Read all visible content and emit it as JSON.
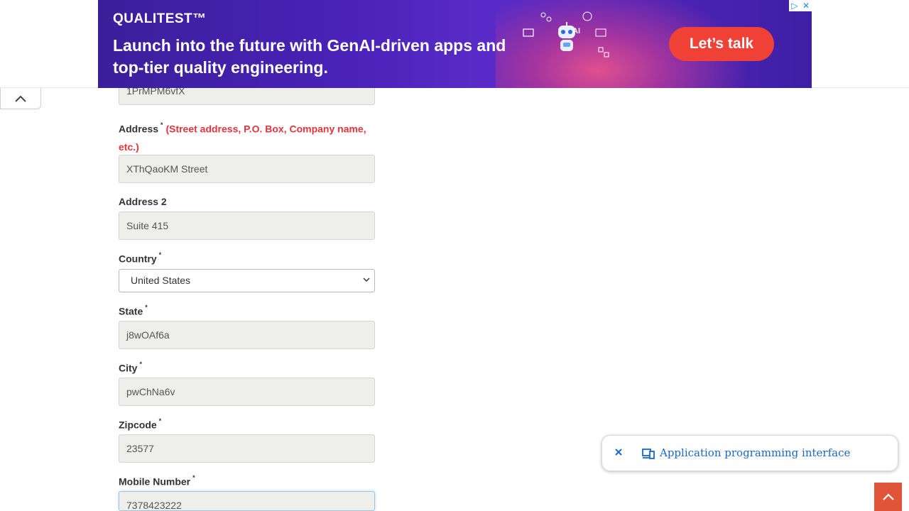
{
  "ad": {
    "brand": "QUALITEST™",
    "headline": "Launch into the future with GenAI-driven apps and top-tier quality engineering.",
    "cta": "Let’s talk",
    "robot_label": "AI"
  },
  "form": {
    "prev_value": "1PrMPM6vfX",
    "address": {
      "label": "Address",
      "required_mark": "*",
      "hint": "(Street address, P.O. Box, Company name, etc.)",
      "value": "XThQaoKM Street"
    },
    "address2": {
      "label": "Address 2",
      "value": "Suite 415"
    },
    "country": {
      "label": "Country",
      "required_mark": "*",
      "selected": "United States"
    },
    "state": {
      "label": "State",
      "required_mark": "*",
      "value": "j8wOAf6a"
    },
    "city": {
      "label": "City",
      "required_mark": "*",
      "value": "pwChNa6v"
    },
    "zipcode": {
      "label": "Zipcode",
      "required_mark": "*",
      "value": "23577"
    },
    "mobile": {
      "label": "Mobile Number",
      "required_mark": "*",
      "value": "7378423222"
    }
  },
  "translate_popup": {
    "text": "Application programming interface"
  },
  "colors": {
    "accent_red": "#e4343c",
    "scroll_top_bg": "#e0553a",
    "ad_cta": "#ef4136",
    "link_blue": "#1a66d2"
  }
}
